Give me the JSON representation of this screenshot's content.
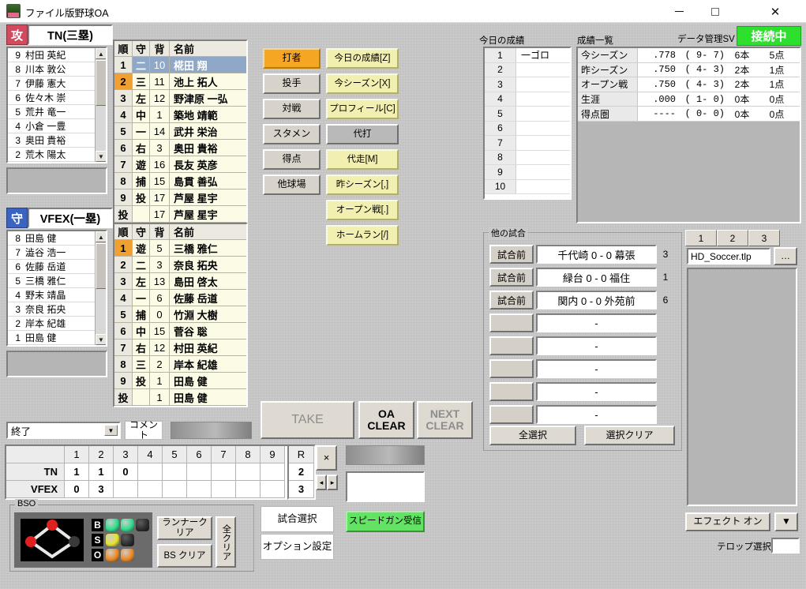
{
  "window": {
    "title": "ファイル版野球OA",
    "minimize": "–",
    "maximize": "❐",
    "close": "✕"
  },
  "colors": {
    "attack_badge": "#d24a5e",
    "defense_badge": "#3b63c2",
    "accent_orange": "#f5a623",
    "accent_yellow": "#f2f0b0",
    "connected_green": "#2ee02e",
    "speedgun_green": "#63e363",
    "lineup_bg": "#fbfbe6",
    "selected_row": "#8fa8c8"
  },
  "attack_team": {
    "badge": "攻",
    "name": "TN(三塁)",
    "roster": [
      {
        "no": "1",
        "name": "築地 靖範"
      },
      {
        "no": "2",
        "name": "荒木 陽太"
      },
      {
        "no": "3",
        "name": "奥田 貴裕"
      },
      {
        "no": "4",
        "name": "小倉 一豊"
      },
      {
        "no": "5",
        "name": "荒井 竜一"
      },
      {
        "no": "6",
        "name": "佐々木 崇"
      },
      {
        "no": "7",
        "name": "伊藤 憲大"
      },
      {
        "no": "8",
        "name": "川本 敦公"
      },
      {
        "no": "9",
        "name": "村田 英紀"
      }
    ],
    "lineup_headers": [
      "順",
      "守",
      "背",
      "名前"
    ],
    "lineup": [
      {
        "order": "1",
        "pos": "二",
        "num": "10",
        "name": "椛田 翔",
        "state": "selected"
      },
      {
        "order": "2",
        "pos": "三",
        "num": "11",
        "name": "池上 拓人",
        "state": "current"
      },
      {
        "order": "3",
        "pos": "左",
        "num": "12",
        "name": "野津原 一弘",
        "state": ""
      },
      {
        "order": "4",
        "pos": "中",
        "num": "1",
        "name": "築地 靖範",
        "state": ""
      },
      {
        "order": "5",
        "pos": "一",
        "num": "14",
        "name": "武井 栄治",
        "state": ""
      },
      {
        "order": "6",
        "pos": "右",
        "num": "3",
        "name": "奥田 貴裕",
        "state": ""
      },
      {
        "order": "7",
        "pos": "遊",
        "num": "16",
        "name": "長友 英彦",
        "state": ""
      },
      {
        "order": "8",
        "pos": "捕",
        "num": "15",
        "name": "島貫 善弘",
        "state": ""
      },
      {
        "order": "9",
        "pos": "投",
        "num": "17",
        "name": "芦屋 星宇",
        "state": ""
      },
      {
        "order": "投",
        "pos": "",
        "num": "17",
        "name": "芦屋 星宇",
        "state": ""
      }
    ]
  },
  "defense_team": {
    "badge": "守",
    "name": "VFEX(一塁)",
    "roster": [
      {
        "no": "0",
        "name": "竹淵 大樹"
      },
      {
        "no": "1",
        "name": "田島 健"
      },
      {
        "no": "2",
        "name": "岸本 紀雄"
      },
      {
        "no": "3",
        "name": "奈良 拓央"
      },
      {
        "no": "4",
        "name": "野末 靖晶"
      },
      {
        "no": "5",
        "name": "三橋 雅仁"
      },
      {
        "no": "6",
        "name": "佐藤 岳道"
      },
      {
        "no": "7",
        "name": "澁谷 浩一"
      },
      {
        "no": "8",
        "name": "田島 健"
      }
    ],
    "lineup_headers": [
      "順",
      "守",
      "背",
      "名前"
    ],
    "lineup": [
      {
        "order": "1",
        "pos": "遊",
        "num": "5",
        "name": "三橋 雅仁",
        "state": "current"
      },
      {
        "order": "2",
        "pos": "二",
        "num": "3",
        "name": "奈良 拓央",
        "state": ""
      },
      {
        "order": "3",
        "pos": "左",
        "num": "13",
        "name": "島田 啓太",
        "state": ""
      },
      {
        "order": "4",
        "pos": "一",
        "num": "6",
        "name": "佐藤 岳道",
        "state": ""
      },
      {
        "order": "5",
        "pos": "捕",
        "num": "0",
        "name": "竹淵 大樹",
        "state": ""
      },
      {
        "order": "6",
        "pos": "中",
        "num": "15",
        "name": "菅谷 聡",
        "state": ""
      },
      {
        "order": "7",
        "pos": "右",
        "num": "12",
        "name": "村田 英紀",
        "state": ""
      },
      {
        "order": "8",
        "pos": "三",
        "num": "2",
        "name": "岸本 紀雄",
        "state": ""
      },
      {
        "order": "9",
        "pos": "投",
        "num": "1",
        "name": "田島 健",
        "state": ""
      },
      {
        "order": "投",
        "pos": "",
        "num": "1",
        "name": "田島 健",
        "state": ""
      }
    ]
  },
  "mode_buttons": [
    {
      "label": "打者",
      "style": "orange"
    },
    {
      "label": "投手",
      "style": "gray"
    },
    {
      "label": "対戦",
      "style": "gray"
    },
    {
      "label": "スタメン",
      "style": "gray"
    },
    {
      "label": "得点",
      "style": "gray"
    },
    {
      "label": "他球場",
      "style": "gray"
    }
  ],
  "action_buttons": [
    {
      "label": "今日の成績[Z]",
      "style": "yellow"
    },
    {
      "label": "今シーズン[X]",
      "style": "yellow"
    },
    {
      "label": "プロフィール[C]",
      "style": "yellow"
    },
    {
      "label": "代打",
      "style": "darkgray"
    },
    {
      "label": "代走[M]",
      "style": "yellow"
    },
    {
      "label": "昨シーズン[,]",
      "style": "yellow"
    },
    {
      "label": "オープン戦[.]",
      "style": "yellow"
    },
    {
      "label": "ホームラン[/]",
      "style": "yellow"
    }
  ],
  "today": {
    "title": "今日の成績",
    "rows": [
      {
        "n": "1",
        "v": "一ゴロ"
      },
      {
        "n": "2",
        "v": ""
      },
      {
        "n": "3",
        "v": ""
      },
      {
        "n": "4",
        "v": ""
      },
      {
        "n": "5",
        "v": ""
      },
      {
        "n": "6",
        "v": ""
      },
      {
        "n": "7",
        "v": ""
      },
      {
        "n": "8",
        "v": ""
      },
      {
        "n": "9",
        "v": ""
      },
      {
        "n": "10",
        "v": ""
      }
    ]
  },
  "stats": {
    "title": "成績一覧",
    "rows": [
      {
        "label": "今シーズン",
        "avg": ".778",
        "ab": "(  9-  7)",
        "hr": "6本",
        "rbi": "5点"
      },
      {
        "label": "昨シーズン",
        "avg": ".750",
        "ab": "(  4-  3)",
        "hr": "2本",
        "rbi": "1点"
      },
      {
        "label": "オープン戦",
        "avg": ".750",
        "ab": "(  4-  3)",
        "hr": "2本",
        "rbi": "1点"
      },
      {
        "label": "生涯",
        "avg": ".000",
        "ab": "(  1-  0)",
        "hr": "0本",
        "rbi": "0点"
      },
      {
        "label": "得点圏",
        "avg": "----",
        "ab": "(  0-  0)",
        "hr": "0本",
        "rbi": "0点"
      }
    ]
  },
  "connection": {
    "label": "データ管理SV",
    "status": "接続中"
  },
  "other_games": {
    "title": "他の試合",
    "rows": [
      {
        "state": "試合前",
        "score": "千代崎  0 - 0   幕張",
        "no": "3"
      },
      {
        "state": "試合前",
        "score": "緑台  0 - 0  福住",
        "no": "1"
      },
      {
        "state": "試合前",
        "score": "関内  0 - 0   外苑前",
        "no": "6"
      },
      {
        "state": "",
        "score": "-",
        "no": ""
      },
      {
        "state": "",
        "score": "-",
        "no": ""
      },
      {
        "state": "",
        "score": "-",
        "no": ""
      },
      {
        "state": "",
        "score": "-",
        "no": ""
      },
      {
        "state": "",
        "score": "-",
        "no": ""
      }
    ],
    "select_all": "全選択",
    "clear_selection": "選択クリア"
  },
  "telop_panel": {
    "tabs": [
      "1",
      "2",
      "3"
    ],
    "file_name": "HD_Soccer.tlp",
    "browse": "…",
    "effect_button": "エフェクト オン",
    "dropdown_arrow": "▼",
    "telop_select_label": "テロップ選択",
    "telop_select_value": ""
  },
  "take_row": {
    "take": "TAKE",
    "oa_clear": "OA\nCLEAR",
    "next_clear": "NEXT\nCLEAR"
  },
  "comment_row": {
    "status_value": "終了",
    "comment_button": "コメント"
  },
  "scoreboard": {
    "innings": [
      "1",
      "2",
      "3",
      "4",
      "5",
      "6",
      "7",
      "8",
      "9"
    ],
    "run_header": "R",
    "teams": [
      {
        "name": "TN",
        "scores": [
          "1",
          "1",
          "0",
          "",
          "",
          "",
          "",
          "",
          ""
        ],
        "runs": "2"
      },
      {
        "name": "VFEX",
        "scores": [
          "0",
          "3",
          "",
          "",
          "",
          "",
          "",
          "",
          ""
        ],
        "runs": "3"
      }
    ],
    "close_button": "×",
    "prev_button": "◂",
    "next_button": "▸"
  },
  "bso": {
    "title": "BSO",
    "labels": [
      "B",
      "S",
      "O"
    ],
    "balls": 2,
    "strikes": 1,
    "outs": 2,
    "runners": {
      "first": false,
      "second": true,
      "third": true
    },
    "runner_clear": "ランナークリア",
    "bs_clear": "BS クリア",
    "all_clear": "全クリア"
  },
  "bottom_buttons": {
    "game_select": "試合選択",
    "option_settings": "オプション設定",
    "speedgun": "スピードガン受信"
  }
}
